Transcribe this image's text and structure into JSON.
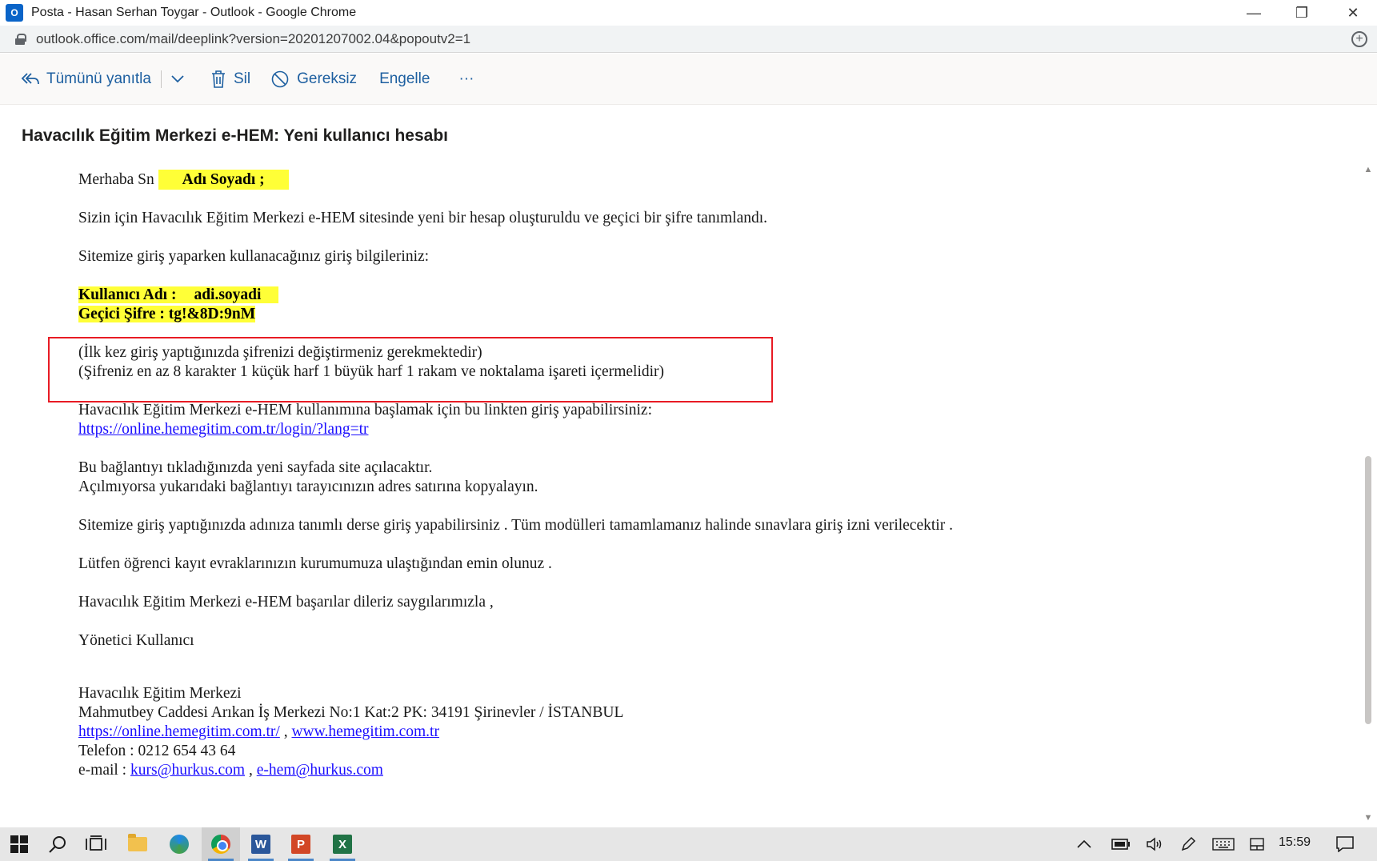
{
  "browser": {
    "window_title": "Posta - Hasan Serhan Toygar - Outlook - Google Chrome",
    "url": "outlook.office.com/mail/deeplink?version=20201207002.04&popoutv2=1",
    "controls": {
      "minimize": "—",
      "restore": "❐",
      "close": "✕"
    }
  },
  "toolbar": {
    "reply_all": "Tümünü yanıtla",
    "delete": "Sil",
    "junk": "Gereksiz",
    "block": "Engelle",
    "more": "···"
  },
  "email": {
    "subject": "Havacılık Eğitim Merkezi e-HEM: Yeni kullanıcı hesabı",
    "greeting_prefix": "Merhaba Sn",
    "greeting_name": "Adı  Soyadı ;",
    "intro": "Sizin için Havacılık Eğitim Merkezi e-HEM sitesinde yeni bir hesap oluşturuldu ve geçici bir şifre tanımlandı.",
    "credentials_intro": "Sitemize giriş yaparken kullanacağınız giriş bilgileriniz:",
    "username_label": "Kullanıcı Adı :",
    "username_value": "adi.soyadi",
    "password_line": "Geçici Şifre : tg!&8D:9nM",
    "note_1": "(İlk kez giriş yaptığınızda şifrenizi değiştirmeniz gerekmektedir)",
    "note_2": "(Şifreniz en az 8 karakter 1 küçük harf 1 büyük harf 1 rakam ve noktalama işareti içermelidir)",
    "start_text": "Havacılık Eğitim Merkezi e-HEM kullanımına başlamak için bu linkten giriş yapabilirsiniz:",
    "login_link": "https://online.hemegitim.com.tr/login/?lang=tr",
    "new_page_text": "Bu bağlantıyı tıkladığınızda yeni sayfada site açılacaktır.",
    "copy_text": "Açılmıyorsa yukarıdaki bağlantıyı tarayıcınızın adres satırına kopyalayın.",
    "course_text": "Sitemize giriş yaptığınızda adınıza tanımlı derse giriş yapabilirsiniz . Tüm modülleri tamamlamanız halinde sınavlara giriş izni verilecektir .",
    "documents_text": "Lütfen öğrenci kayıt evraklarınızın kurumumuza ulaştığından emin olunuz .",
    "wishes_text": "Havacılık Eğitim Merkezi e-HEM başarılar dileriz saygılarımızla ,",
    "sign_off": "Yönetici Kullanıcı",
    "signature": {
      "org": "Havacılık Eğitim Merkezi",
      "address": "Mahmutbey Caddesi Arıkan İş Merkezi No:1 Kat:2 PK: 34191 Şirinevler / İSTANBUL",
      "link_1": "https://online.hemegitim.com.tr/",
      "link_sep": " , ",
      "link_2": "www.hemegitim.com.tr",
      "phone": "Telefon : 0212 654 43 64",
      "email_prefix": "e-mail : ",
      "email_1": "kurs@hurkus.com",
      "email_2": "e-hem@hurkus.com"
    }
  },
  "taskbar": {
    "clock": "15:59",
    "apps": [
      "windows-start-icon",
      "search-icon",
      "task-view-icon",
      "file-explorer-icon",
      "edge-icon",
      "chrome-icon",
      "word-icon",
      "powerpoint-icon",
      "excel-icon"
    ],
    "tray": [
      "chevron-up-icon",
      "battery-icon",
      "volume-icon",
      "pen-icon",
      "keyboard-icon",
      "tablet-icon",
      "notification-icon"
    ],
    "word_letter": "W",
    "ppt_letter": "P",
    "xls_letter": "X"
  },
  "colors": {
    "highlight": "#ffff37",
    "link": "#1a0dff",
    "red_box": "#e81b24",
    "outlook_blue": "#1d5fa0"
  }
}
